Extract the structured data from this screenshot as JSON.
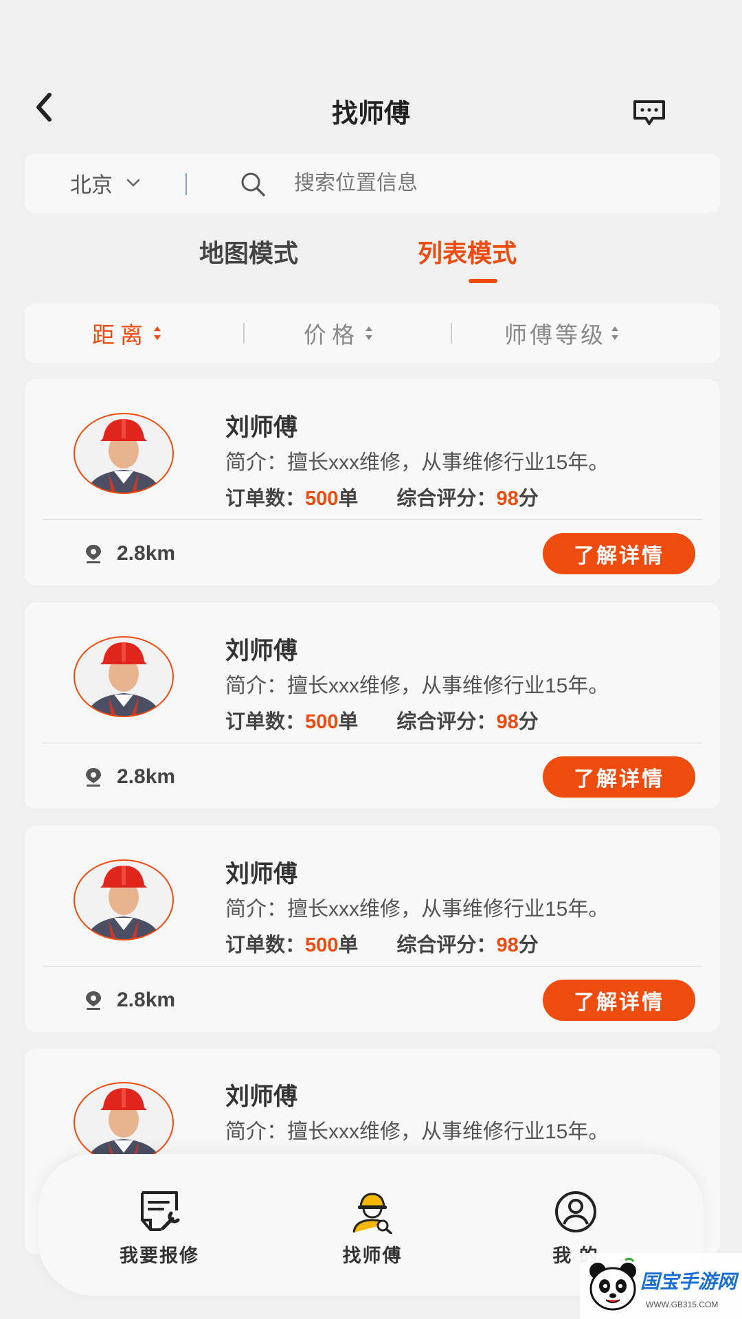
{
  "header": {
    "title": "找师傅",
    "back_icon": "chevron-left-icon",
    "message_icon": "chat-bubble-icon"
  },
  "search": {
    "city": "北京",
    "placeholder": "搜索位置信息"
  },
  "mode_tabs": [
    {
      "label": "地图模式",
      "active": false
    },
    {
      "label": "列表模式",
      "active": true
    }
  ],
  "sort": [
    {
      "label": "距离",
      "active": true
    },
    {
      "label": "价格",
      "active": false
    },
    {
      "label": "师傅等级",
      "active": false
    }
  ],
  "workers": [
    {
      "name": "刘师傅",
      "intro": "简介：擅长xxx维修，从事维修行业15年。",
      "orders_label": "订单数：",
      "orders": "500",
      "orders_unit": "单",
      "rating_label": "综合评分：",
      "rating": "98",
      "rating_unit": "分",
      "distance": "2.8km",
      "button": "了解详情"
    },
    {
      "name": "刘师傅",
      "intro": "简介：擅长xxx维修，从事维修行业15年。",
      "orders_label": "订单数：",
      "orders": "500",
      "orders_unit": "单",
      "rating_label": "综合评分：",
      "rating": "98",
      "rating_unit": "分",
      "distance": "2.8km",
      "button": "了解详情"
    },
    {
      "name": "刘师傅",
      "intro": "简介：擅长xxx维修，从事维修行业15年。",
      "orders_label": "订单数：",
      "orders": "500",
      "orders_unit": "单",
      "rating_label": "综合评分：",
      "rating": "98",
      "rating_unit": "分",
      "distance": "2.8km",
      "button": "了解详情"
    },
    {
      "name": "刘师傅",
      "intro": "简介：擅长xxx维修，从事维修行业15年。"
    }
  ],
  "bottom_nav": [
    {
      "label": "我要报修",
      "icon": "repair-form-icon"
    },
    {
      "label": "找师傅",
      "icon": "worker-search-icon"
    },
    {
      "label": "我 的",
      "icon": "user-profile-icon"
    }
  ],
  "watermark": {
    "brand": "国宝手游网",
    "url": "WWW.GB315.COM"
  },
  "colors": {
    "accent": "#ee4b0f",
    "background": "#f0f0f0",
    "card": "#f8f8f8"
  }
}
